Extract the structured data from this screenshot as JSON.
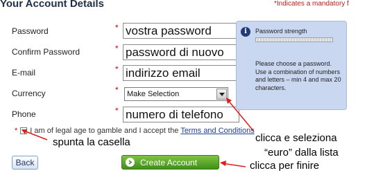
{
  "header": {
    "title": "Your Account Details",
    "mandatory_note": "*Indicates a mandatory f"
  },
  "required_marker": "*",
  "form": {
    "password": {
      "label": "Password",
      "value": "vostra password"
    },
    "confirm_password": {
      "label": "Confirm Password",
      "value": "password di nuovo"
    },
    "email": {
      "label": "E-mail",
      "value": "indirizzo email"
    },
    "currency": {
      "label": "Currency",
      "selected": "Make Selection"
    },
    "phone": {
      "label": "Phone",
      "value": "numero di telefono"
    }
  },
  "password_strength": {
    "icon": "info-icon",
    "title": "Password strength",
    "help": "Please choose a password. Use a combination of numbers and letters – min 4 and max 20 characters."
  },
  "agreement": {
    "marker": "*",
    "text": "I am of legal age to gamble and I accept the",
    "link": "Terms and Conditions"
  },
  "buttons": {
    "back": "Back",
    "create_account": "Create Account"
  },
  "annotations": {
    "tick_box": "spunta la casella",
    "select_line1": "clicca e seleziona",
    "select_line2": "“euro” dalla lista",
    "click_finish": "clicca per finire"
  },
  "colors": {
    "title": "#1f2f46",
    "required": "#d40000",
    "tooltip_bg": "#c9d7f0",
    "create_button": "#4fa321",
    "arrow": "#e21b1b"
  }
}
